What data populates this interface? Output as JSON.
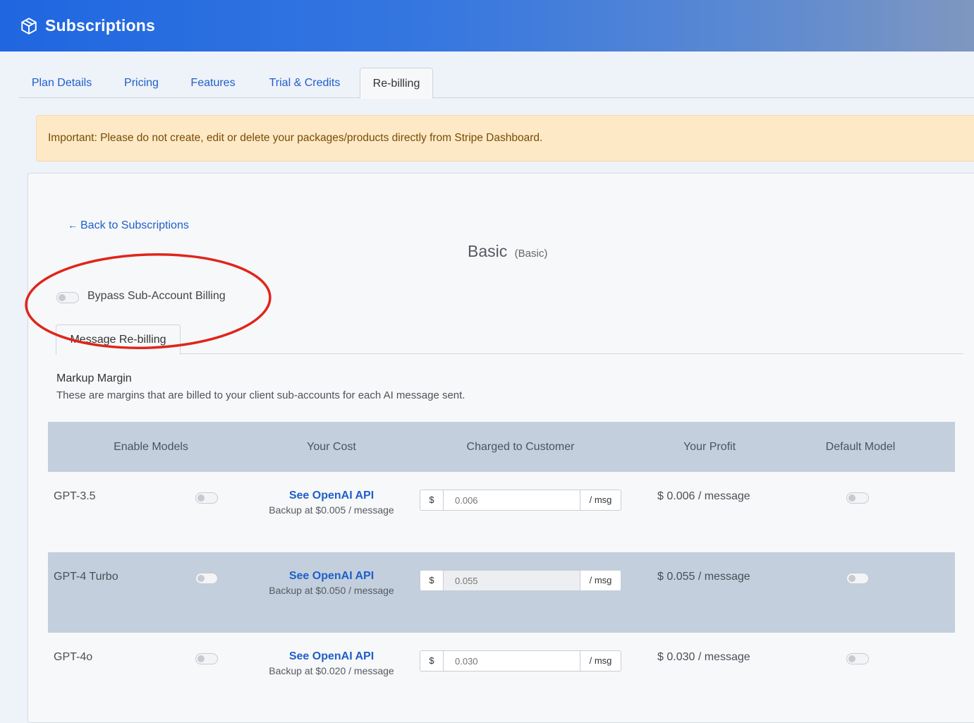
{
  "header": {
    "title": "Subscriptions",
    "icon": "box-icon"
  },
  "tabs": [
    {
      "label": "Plan Details"
    },
    {
      "label": "Pricing"
    },
    {
      "label": "Features"
    },
    {
      "label": "Trial & Credits"
    },
    {
      "label": "Re-billing",
      "active": true
    }
  ],
  "alert": {
    "text": "Important: Please do not create, edit or delete your packages/products directly from Stripe Dashboard."
  },
  "back_link": {
    "label": "Back to Subscriptions",
    "icon": "arrow-left-icon"
  },
  "plan": {
    "name": "Basic",
    "subname": "(Basic)"
  },
  "bypass": {
    "label": "Bypass Sub-Account Billing",
    "enabled": false
  },
  "subtab": {
    "label": "Message Re-billing"
  },
  "markup": {
    "title": "Markup Margin",
    "description": "These are margins that are billed to your client sub-accounts for each AI message sent."
  },
  "table": {
    "headers": {
      "enable": "Enable Models",
      "cost": "Your Cost",
      "charged": "Charged to Customer",
      "profit": "Your Profit",
      "default": "Default Model"
    },
    "rows": [
      {
        "model": "GPT-3.5",
        "cost_link": "See OpenAI API",
        "backup": "Backup at $0.005 / message",
        "currency": "$",
        "placeholder": "0.006",
        "suffix": "/ msg",
        "profit": "$ 0.006 / message"
      },
      {
        "model": "GPT-4 Turbo",
        "cost_link": "See OpenAI API",
        "backup": "Backup at $0.050 / message",
        "currency": "$",
        "placeholder": "0.055",
        "suffix": "/ msg",
        "profit": "$ 0.055 / message"
      },
      {
        "model": "GPT-4o",
        "cost_link": "See OpenAI API",
        "backup": "Backup at $0.020 / message",
        "currency": "$",
        "placeholder": "0.030",
        "suffix": "/ msg",
        "profit": "$ 0.030 / message"
      }
    ]
  },
  "colors": {
    "accent": "#1f5fc8",
    "header_gradient_start": "#1f66e0",
    "alert_bg": "#fde9c6",
    "table_head_bg": "#c3cfdc",
    "annotation": "#e0251a"
  }
}
